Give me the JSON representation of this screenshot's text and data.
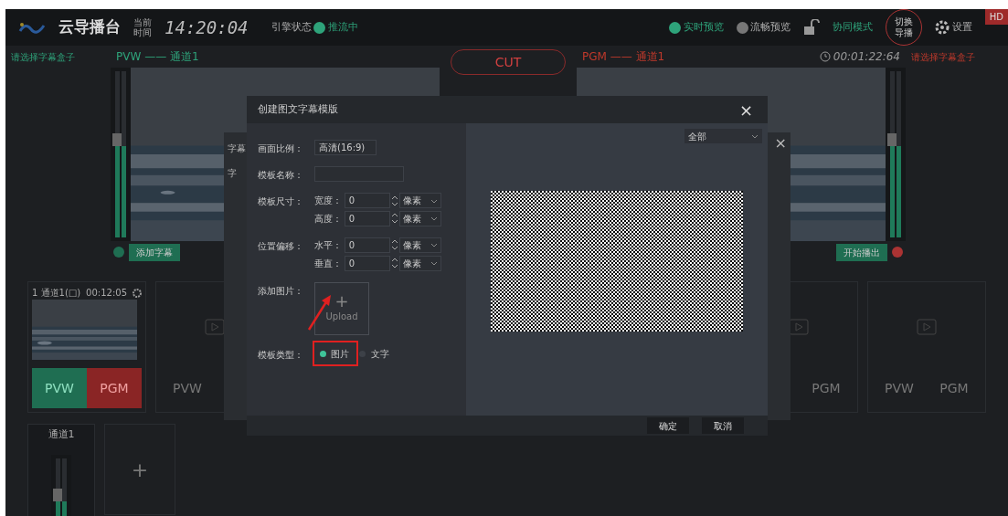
{
  "topbar": {
    "title": "云导播台",
    "time_label": [
      "当前",
      "时间"
    ],
    "time": "14:20:04",
    "engine_label": "引擎状态",
    "engine_status": "推流中",
    "preview_modes": [
      {
        "label": "实时预览",
        "selected": true
      },
      {
        "label": "流畅预览",
        "selected": false
      }
    ],
    "coop_mode": "协同模式",
    "switch_button": [
      "切换",
      "导播"
    ],
    "settings": "设置",
    "badge": "HD"
  },
  "pvw": {
    "subtitle_select": "请选择字幕盒子",
    "title": "PVW —— 通道1",
    "level": 0.55,
    "add_subtitle": "添加字幕"
  },
  "cut": "CUT",
  "pgm": {
    "title": "PGM —— 通道1",
    "timer": "00:01:22:64",
    "subtitle_select": "请选择字幕盒子",
    "level": 0.55,
    "start_button": "开始播出"
  },
  "sources": [
    {
      "kind": "video",
      "name": "1 通道1(□)",
      "duration": "00:12:05",
      "pvw": "PVW",
      "pgm": "PGM"
    },
    {
      "kind": "empty",
      "pvw": "PVW"
    },
    {
      "kind": "empty",
      "pgm": "PGM"
    },
    {
      "kind": "empty",
      "pvw": "PVW",
      "pgm": "PGM"
    }
  ],
  "audio": {
    "name": "通道1",
    "level": 0.3,
    "add": "+"
  },
  "back_dialog": {
    "label_1": "字幕",
    "label_2": "字",
    "close": "×"
  },
  "modal": {
    "title": "创建图文字幕模版",
    "close": "×",
    "aspect": {
      "label": "画面比例：",
      "value": "高清(16:9)"
    },
    "name": {
      "label": "模板名称："
    },
    "size": {
      "label": "模板尺寸：",
      "rows": [
        {
          "label": "宽度：",
          "value": "0",
          "unit": "像素"
        },
        {
          "label": "高度：",
          "value": "0",
          "unit": "像素"
        }
      ]
    },
    "offset": {
      "label": "位置偏移：",
      "rows": [
        {
          "label": "水平：",
          "value": "0",
          "unit": "像素"
        },
        {
          "label": "垂直：",
          "value": "0",
          "unit": "像素"
        }
      ]
    },
    "upload": {
      "label": "添加图片：",
      "plus": "+",
      "text": "Upload"
    },
    "type": {
      "label": "模板类型：",
      "options": [
        {
          "label": "图片",
          "selected": true
        },
        {
          "label": "文字",
          "selected": false
        }
      ]
    },
    "filter": "全部",
    "buttons": [
      "确定",
      "取消"
    ]
  }
}
